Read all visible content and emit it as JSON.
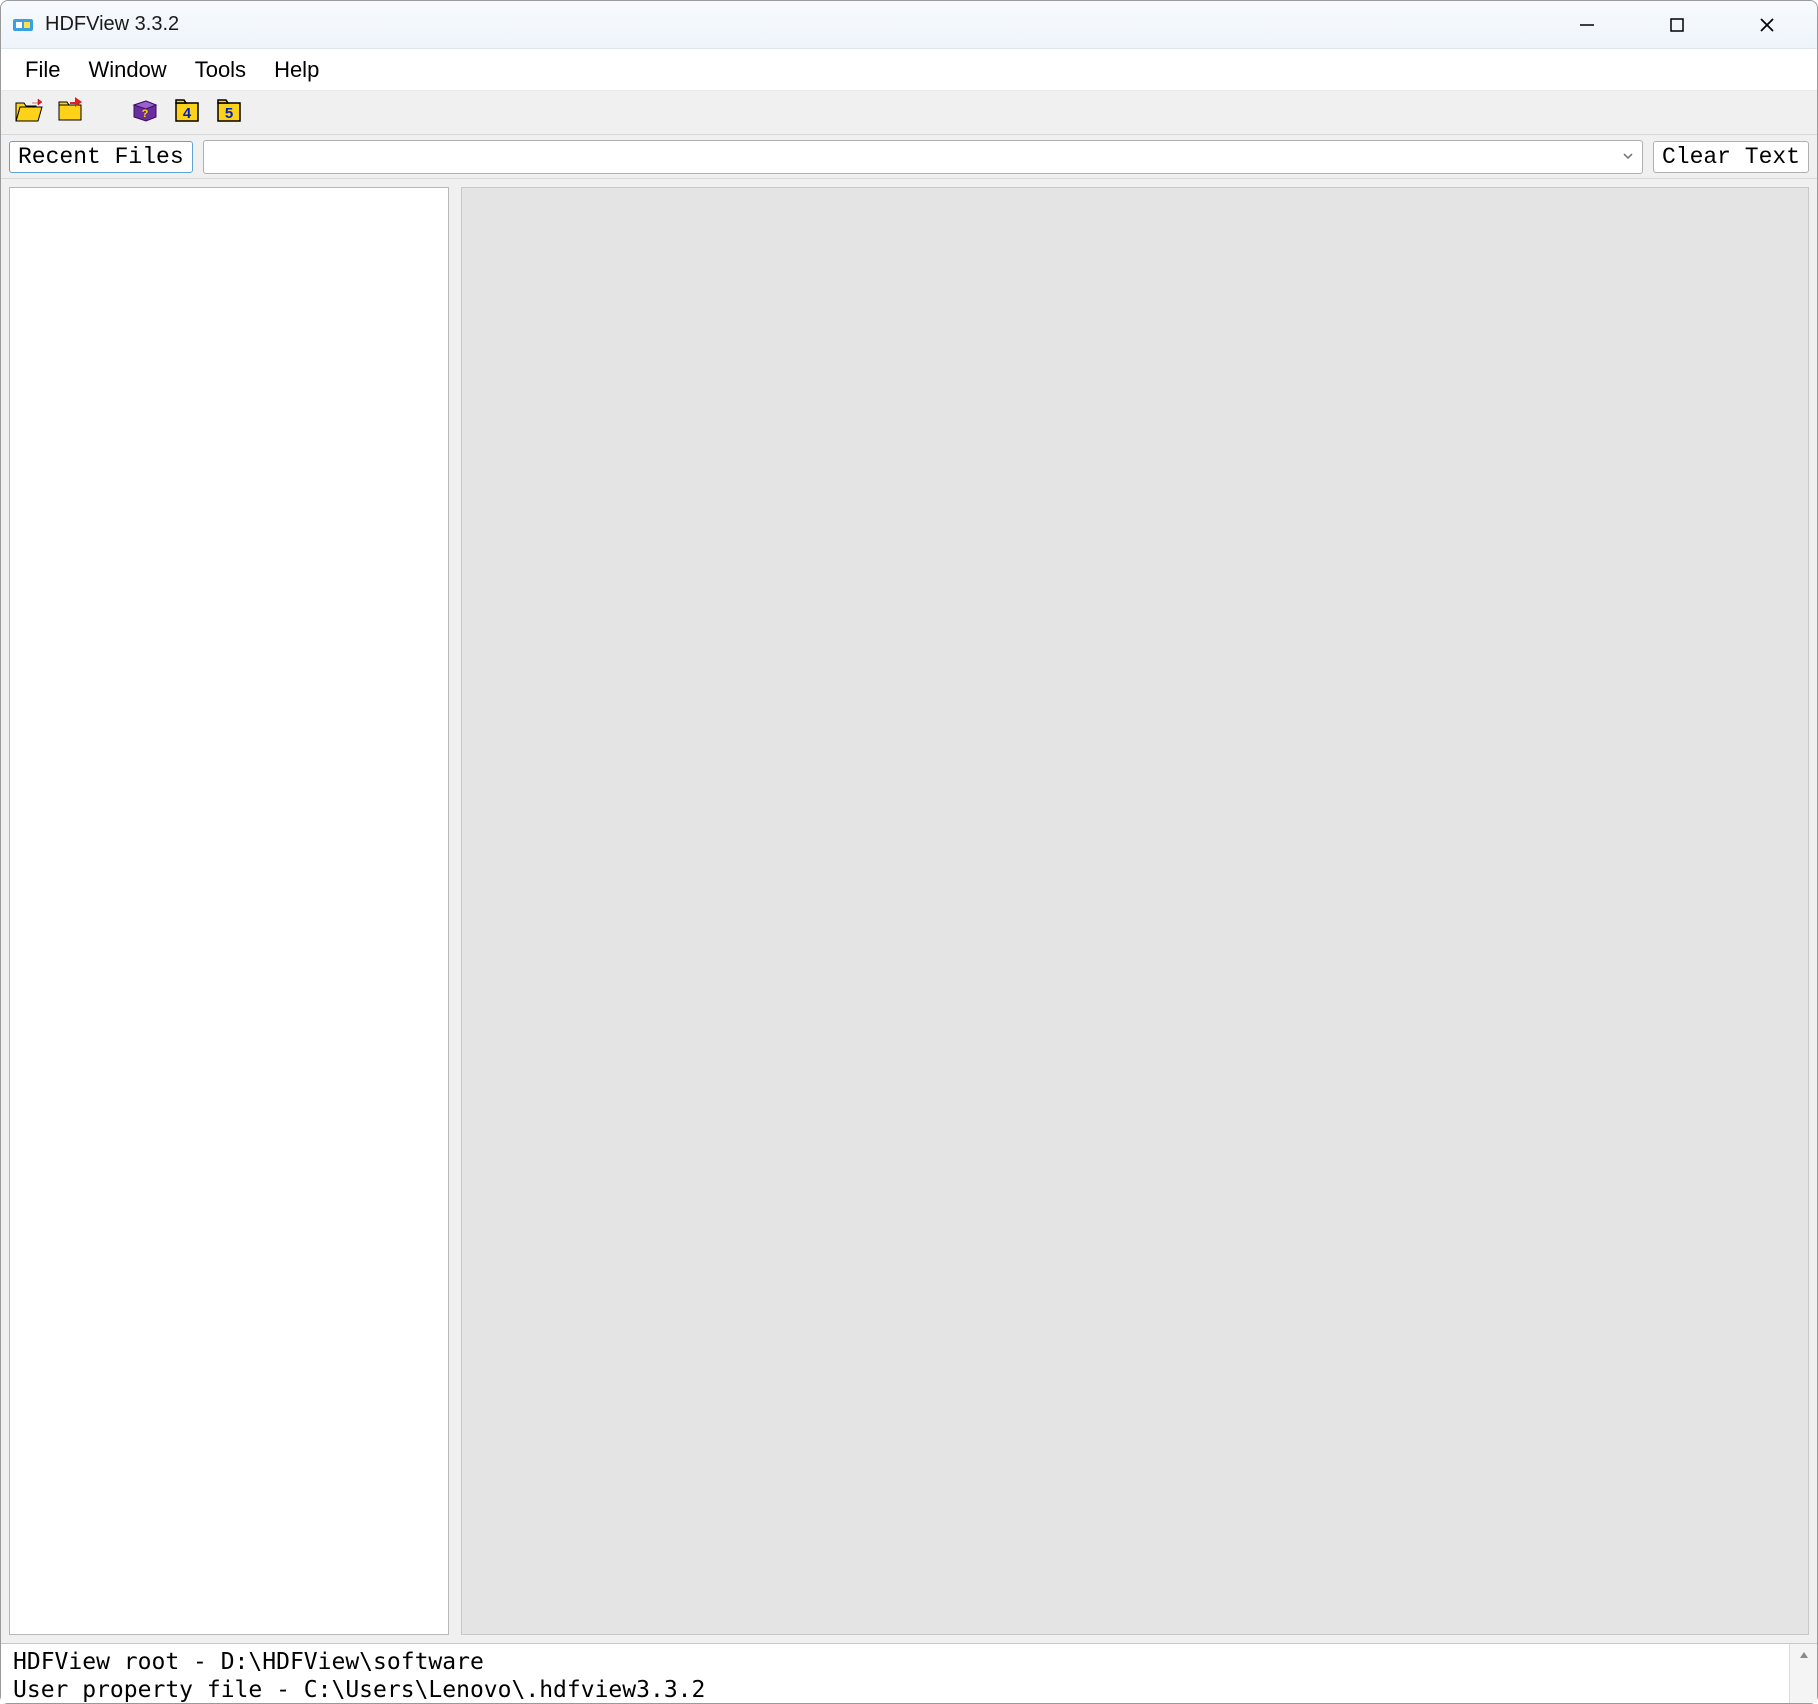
{
  "window": {
    "title": "HDFView 3.3.2"
  },
  "menu": {
    "items": [
      "File",
      "Window",
      "Tools",
      "Help"
    ]
  },
  "toolbar": {
    "icons": [
      "open-file-icon",
      "close-file-icon",
      "help-book-icon",
      "hdf4-icon",
      "hdf5-icon"
    ]
  },
  "recent": {
    "button_label": "Recent Files",
    "combo_value": "",
    "clear_label": "Clear Text"
  },
  "log": {
    "line1": "HDFView root - D:\\HDFView\\software",
    "line2": "User property file - C:\\Users\\Lenovo\\.hdfview3.3.2"
  }
}
